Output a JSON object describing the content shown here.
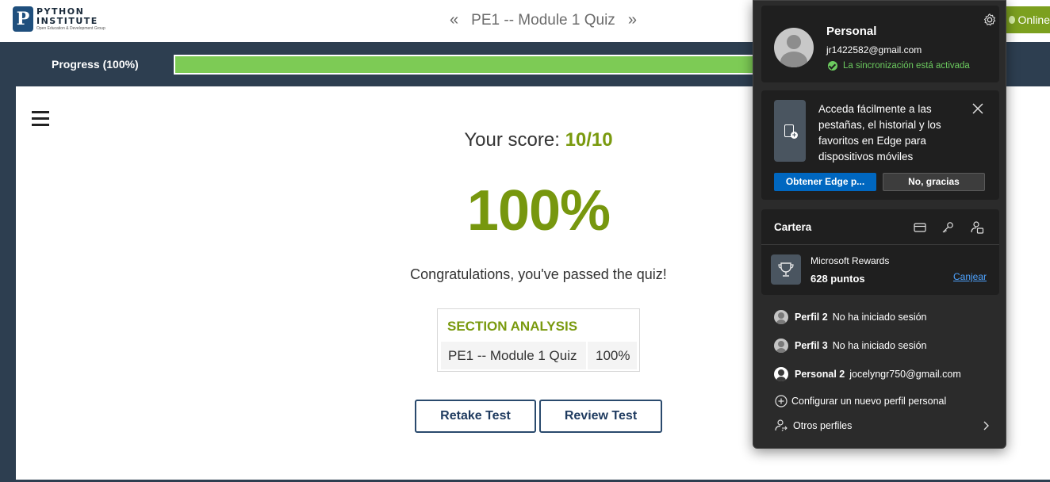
{
  "header": {
    "logo_line1": "PYTHON",
    "logo_line2": "INSTITUTE",
    "logo_tagline": "Open Education & Development Group",
    "page_title": "PE1 -- Module 1 Quiz",
    "prev_arrow": "«",
    "next_arrow": "»",
    "online_label": "Online"
  },
  "progress": {
    "label": "Progress (100%)",
    "fraction": 1.0
  },
  "quiz": {
    "score_label": "Your score: ",
    "score_value": "10/10",
    "percent": "100%",
    "congrats": "Congratulations, you've passed the quiz!",
    "section_title": "SECTION ANALYSIS",
    "section_rows": [
      {
        "name": "PE1 -- Module 1 Quiz",
        "pct": "100%"
      }
    ],
    "retake_label": "Retake Test",
    "review_label": "Review Test"
  },
  "profile_popup": {
    "name": "Personal",
    "email": "jr1422582@gmail.com",
    "sync_status": "La sincronización está activada",
    "promo_text": "Acceda fácilmente a las pestañas, el historial y los favoritos en Edge para dispositivos móviles",
    "promo_primary": "Obtener Edge p...",
    "promo_secondary": "No, gracias",
    "wallet_title": "Cartera",
    "rewards_name": "Microsoft Rewards",
    "rewards_points": "628 puntos",
    "rewards_link": "Canjear",
    "other_profiles": [
      {
        "name": "Perfil 2",
        "status": "No ha iniciado sesión"
      },
      {
        "name": "Perfil 3",
        "status": "No ha iniciado sesión"
      },
      {
        "name": "Personal 2",
        "status": "jocelyngr750@gmail.com"
      }
    ],
    "add_profile": "Configurar un nuevo perfil personal",
    "more_profiles": "Otros perfiles"
  },
  "colors": {
    "nav_dark": "#2d3e50",
    "accent_green": "#77970e",
    "progress_green": "#7dcb55",
    "online_green": "#7ca01f",
    "edge_blue": "#0067c0",
    "popup_bg": "#2b2b2b"
  },
  "icons": [
    "settings-gear-icon",
    "avatar-icon",
    "sync-check-icon",
    "phone-add-icon",
    "close-icon",
    "card-icon",
    "key-icon",
    "person-badge-icon",
    "trophy-icon",
    "add-circle-icon",
    "person-switch-icon",
    "chevron-right-icon",
    "hamburger-menu-icon"
  ]
}
